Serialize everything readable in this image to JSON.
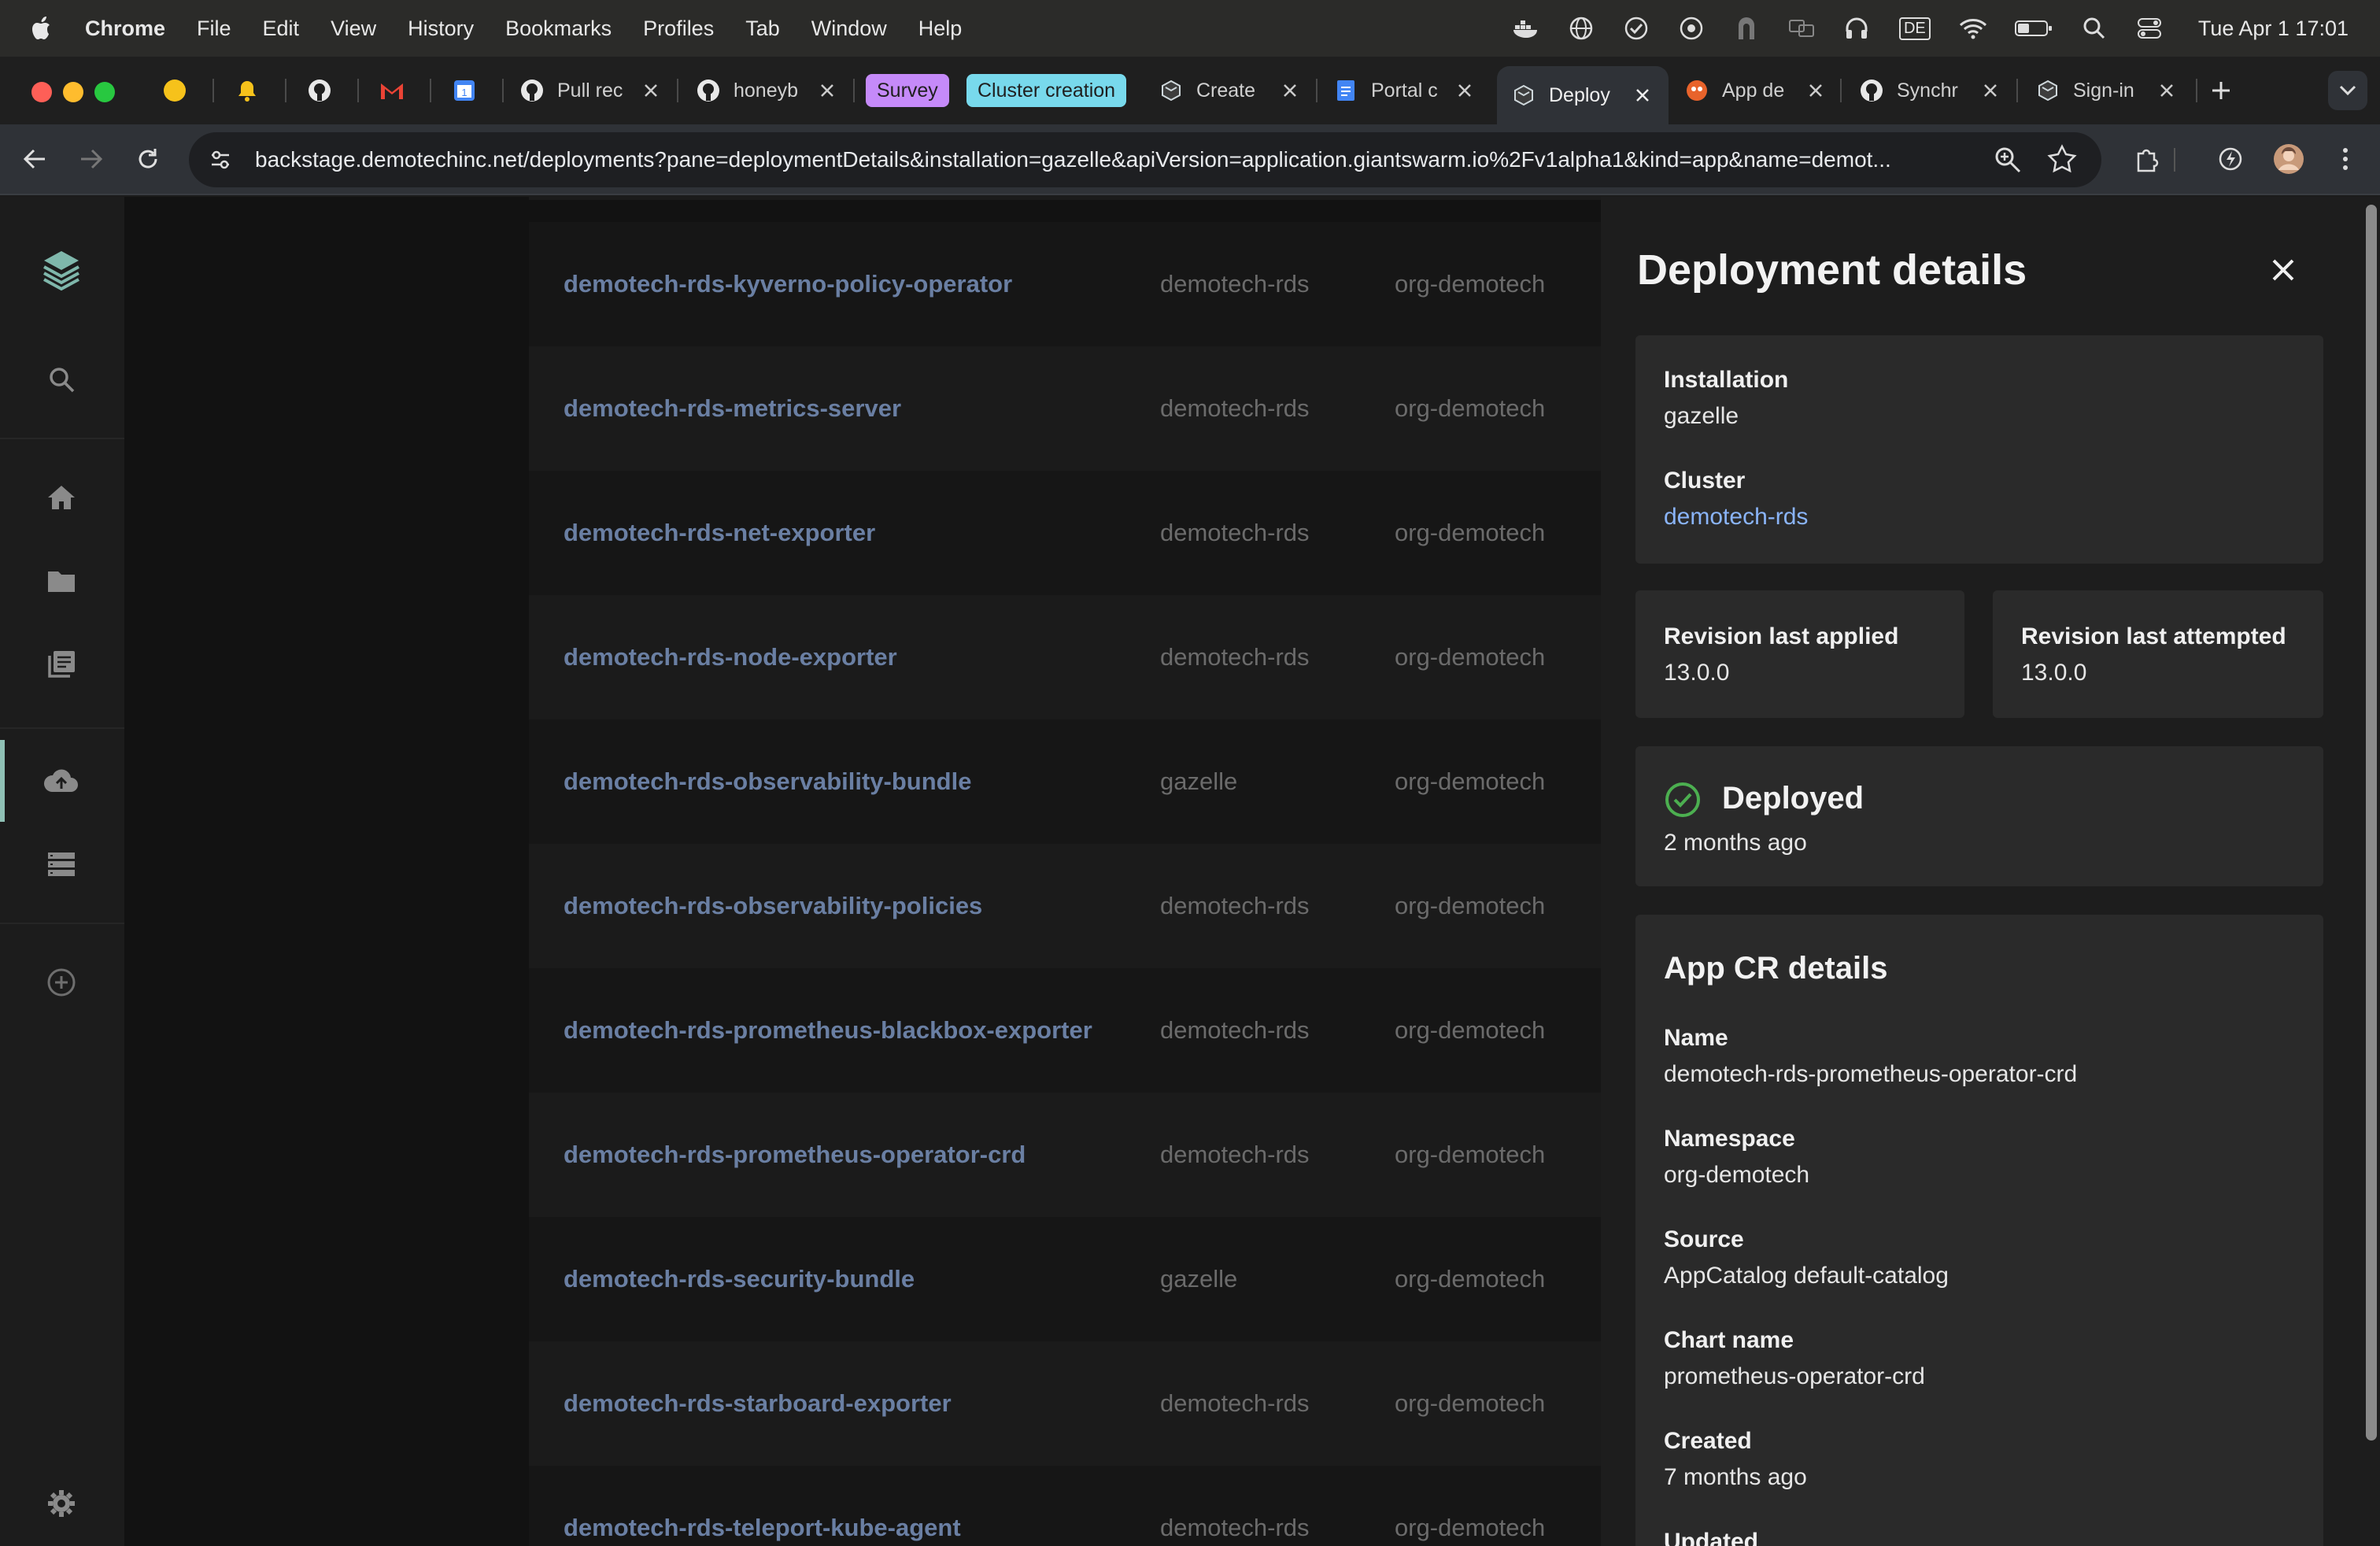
{
  "menubar": {
    "app": "Chrome",
    "items": [
      "File",
      "Edit",
      "View",
      "History",
      "Bookmarks",
      "Profiles",
      "Tab",
      "Window",
      "Help"
    ],
    "keyboard_layout": "DE",
    "clock": "Tue Apr 1  17:01"
  },
  "tabs": [
    {
      "title": "Pull rec"
    },
    {
      "title": "honeyb"
    },
    {
      "pill": "Survey"
    },
    {
      "pill": "Cluster creation"
    },
    {
      "title": "Create"
    },
    {
      "title": "Portal c"
    },
    {
      "title": "Deploy"
    },
    {
      "title": "App de"
    },
    {
      "title": "Synchr"
    },
    {
      "title": "Sign-in"
    }
  ],
  "address_bar": {
    "url": "backstage.demotechinc.net/deployments?pane=deploymentDetails&installation=gazelle&apiVersion=application.giantswarm.io%2Fv1alpha1&kind=app&name=demot..."
  },
  "deployments": [
    {
      "name": "demotech-rds-kyverno-policy-operator",
      "cluster": "demotech-rds",
      "org": "org-demotech"
    },
    {
      "name": "demotech-rds-metrics-server",
      "cluster": "demotech-rds",
      "org": "org-demotech"
    },
    {
      "name": "demotech-rds-net-exporter",
      "cluster": "demotech-rds",
      "org": "org-demotech"
    },
    {
      "name": "demotech-rds-node-exporter",
      "cluster": "demotech-rds",
      "org": "org-demotech"
    },
    {
      "name": "demotech-rds-observability-bundle",
      "cluster": "gazelle",
      "org": "org-demotech"
    },
    {
      "name": "demotech-rds-observability-policies",
      "cluster": "demotech-rds",
      "org": "org-demotech"
    },
    {
      "name": "demotech-rds-prometheus-blackbox-exporter",
      "cluster": "demotech-rds",
      "org": "org-demotech"
    },
    {
      "name": "demotech-rds-prometheus-operator-crd",
      "cluster": "demotech-rds",
      "org": "org-demotech"
    },
    {
      "name": "demotech-rds-security-bundle",
      "cluster": "gazelle",
      "org": "org-demotech"
    },
    {
      "name": "demotech-rds-starboard-exporter",
      "cluster": "demotech-rds",
      "org": "org-demotech"
    },
    {
      "name": "demotech-rds-teleport-kube-agent",
      "cluster": "demotech-rds",
      "org": "org-demotech"
    }
  ],
  "drawer": {
    "title": "Deployment details",
    "installation_label": "Installation",
    "installation": "gazelle",
    "cluster_label": "Cluster",
    "cluster": "demotech-rds",
    "rev_applied_label": "Revision last applied",
    "rev_applied": "13.0.0",
    "rev_attempted_label": "Revision last attempted",
    "rev_attempted": "13.0.0",
    "status": "Deployed",
    "status_time": "2 months ago",
    "status_color": "#4caf50",
    "cr_title": "App CR details",
    "name_label": "Name",
    "name": "demotech-rds-prometheus-operator-crd",
    "namespace_label": "Namespace",
    "namespace": "org-demotech",
    "source_label": "Source",
    "source": "AppCatalog default-catalog",
    "chart_label": "Chart name",
    "chart": "prometheus-operator-crd",
    "created_label": "Created",
    "created": "7 months ago",
    "updated_label": "Updated"
  },
  "icons": {
    "sidebar": [
      "backstage-logo-icon",
      "search-icon",
      "home-icon",
      "folder-icon",
      "docs-icon",
      "deployments-icon",
      "list-icon",
      "create-icon",
      "settings-icon"
    ]
  }
}
